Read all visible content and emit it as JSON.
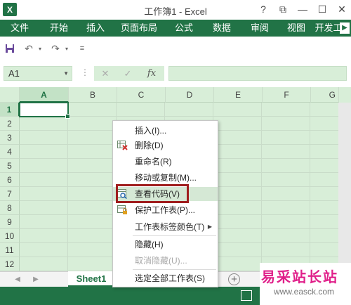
{
  "window": {
    "app_icon": "X",
    "title": "工作簿1 - Excel",
    "help_glyph": "?",
    "restore_glyph": "⧉",
    "minimize_glyph": "—",
    "maximize_glyph": "☐",
    "close_glyph": "✕"
  },
  "ribbon": {
    "file_tab": "文件",
    "tabs": [
      "开始",
      "插入",
      "页面布局",
      "公式",
      "数据",
      "审阅",
      "视图",
      "开发工"
    ],
    "scroll_glyph": "▶"
  },
  "qat": {
    "save_icon": "save-icon",
    "undo_glyph": "↶",
    "redo_glyph": "↷",
    "customize_glyph": "≡"
  },
  "formula_bar": {
    "name_box": "A1",
    "name_box_dropdown": "▼",
    "vdots": "⋮",
    "cancel_glyph": "✕",
    "enter_glyph": "✓",
    "fx_label": "fx",
    "formula_value": ""
  },
  "grid": {
    "columns": [
      "A",
      "B",
      "C",
      "D",
      "E",
      "F",
      "G"
    ],
    "rows": [
      "1",
      "2",
      "3",
      "4",
      "5",
      "6",
      "7",
      "8",
      "9",
      "10",
      "11",
      "12"
    ],
    "active_cell": "A1"
  },
  "sheets": {
    "prev_glyph": "◀",
    "next_glyph": "▶",
    "tabs": [
      "Sheet1"
    ],
    "add_glyph": "+"
  },
  "context_menu": {
    "items": [
      {
        "label": "插入(I)...",
        "icon": ""
      },
      {
        "label": "删除(D)",
        "icon": "delete-sheet-icon"
      },
      {
        "label": "重命名(R)",
        "icon": ""
      },
      {
        "label": "移动或复制(M)...",
        "icon": ""
      },
      {
        "label": "查看代码(V)",
        "icon": "view-code-icon"
      },
      {
        "label": "保护工作表(P)...",
        "icon": "protect-sheet-icon"
      },
      {
        "label": "工作表标签颜色(T)",
        "icon": "",
        "submenu_glyph": "▶"
      },
      {
        "label": "隐藏(H)",
        "icon": ""
      },
      {
        "label": "取消隐藏(U)...",
        "icon": "",
        "disabled": true
      },
      {
        "label": "选定全部工作表(S)",
        "icon": ""
      }
    ],
    "highlight_color": "#a01e1e"
  },
  "watermark": {
    "title": "易采站长站",
    "url": "www.easck.com"
  },
  "colors": {
    "accent": "#217346",
    "grid_bg": "#d8eed8"
  }
}
